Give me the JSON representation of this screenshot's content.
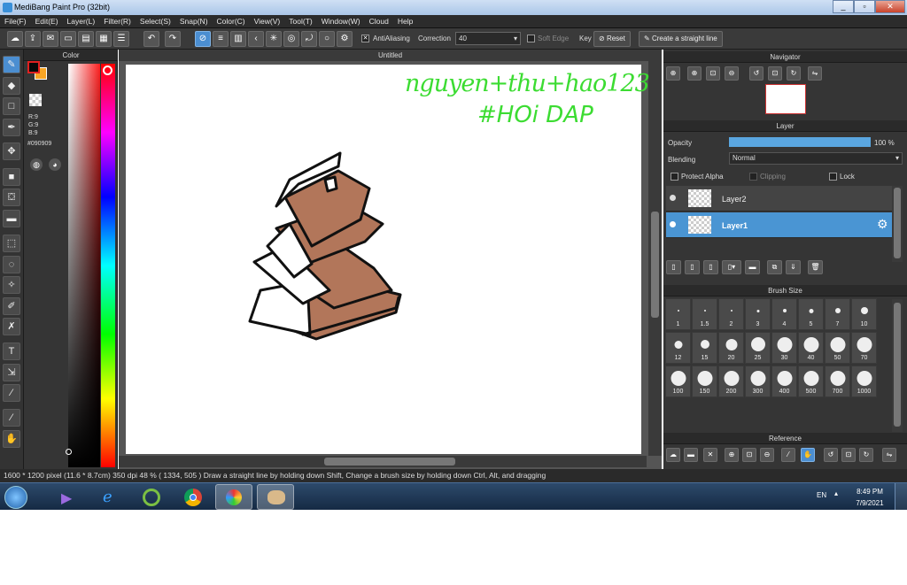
{
  "window": {
    "title": "MediBang Paint Pro (32bit)",
    "minimize": "_",
    "restore": "▫",
    "close": "✕"
  },
  "menu": [
    "File(F)",
    "Edit(E)",
    "Layer(L)",
    "Filter(R)",
    "Select(S)",
    "Snap(N)",
    "Color(C)",
    "View(V)",
    "Tool(T)",
    "Window(W)",
    "Cloud",
    "Help"
  ],
  "toolbar": {
    "antialiasing_label": "AntiAliasing",
    "correction_label": "Correction",
    "correction_value": "40",
    "soft_edge_label": "Soft Edge",
    "key_label": "Key",
    "reset_label": "Reset",
    "straight_line_label": "Create a straight line"
  },
  "color_panel": {
    "title": "Color",
    "r": "R:9",
    "g": "G:9",
    "b": "B:9",
    "hex": "#090909",
    "fg_color": "#090909",
    "bg_color": "#f7a525"
  },
  "canvas": {
    "tab_title": "Untitled",
    "handwriting_line1": "nguyen+thu+hao123",
    "handwriting_line2": "#HOi DAP"
  },
  "navigator": {
    "title": "Navigator"
  },
  "layer_panel": {
    "title": "Layer",
    "opacity_label": "Opacity",
    "opacity_value": "100 %",
    "blending_label": "Blending",
    "blending_value": "Normal",
    "protect_alpha": "Protect Alpha",
    "clipping": "Clipping",
    "lock": "Lock",
    "layers": [
      {
        "name": "Layer2",
        "selected": false
      },
      {
        "name": "Layer1",
        "selected": true
      }
    ]
  },
  "brush_panel": {
    "title": "Brush Size",
    "sizes": [
      "1",
      "1.5",
      "2",
      "3",
      "4",
      "5",
      "7",
      "10",
      "12",
      "15",
      "20",
      "25",
      "30",
      "40",
      "50",
      "70",
      "100",
      "150",
      "200",
      "300",
      "400",
      "500",
      "700",
      "1000"
    ]
  },
  "reference": {
    "title": "Reference"
  },
  "statusbar": {
    "text": "1600 * 1200 pixel   (11.6 * 8.7cm)   350 dpi   48 %   ( 1334, 505 )   Draw a straight line by holding down Shift, Change a brush size by holding down Ctrl, Alt, and dragging"
  },
  "taskbar": {
    "lang": "EN",
    "time": "8:49 PM",
    "date": "7/9/2021"
  }
}
